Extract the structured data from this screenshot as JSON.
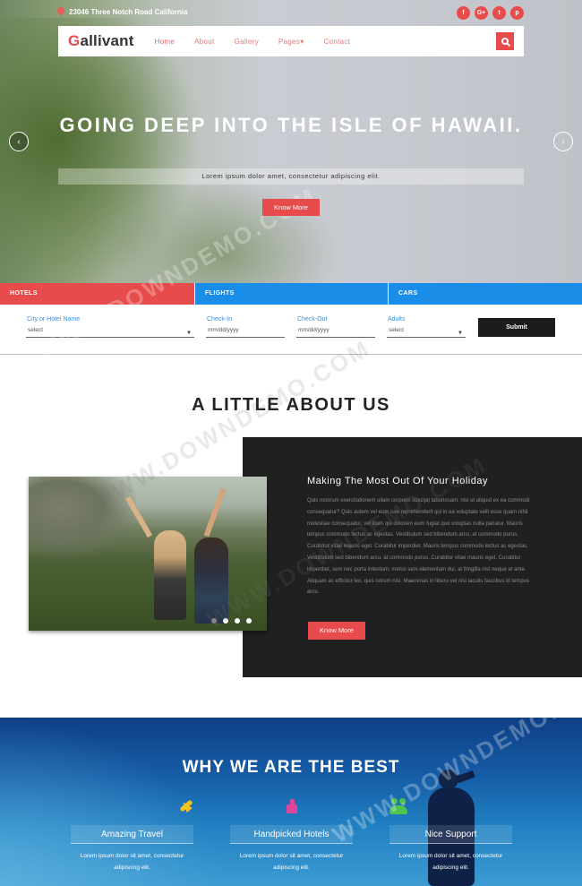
{
  "topbar": {
    "address": "23046 Three Notch Road California",
    "social": [
      "f",
      "G+",
      "t",
      "p"
    ]
  },
  "navbar": {
    "logo_first": "G",
    "logo_rest": "allivant",
    "menu": [
      "Home",
      "About",
      "Gallery",
      "Pages▾",
      "Contact"
    ],
    "search_icon": "search-icon"
  },
  "hero": {
    "title": "GOING DEEP INTO THE ISLE OF HAWAII.",
    "subtitle": "Lorem ipsum dolor amet, consectetur adipiscing elit.",
    "button": "Know More",
    "prev": "‹",
    "next": "›"
  },
  "booking": {
    "tabs": [
      "HOTELS",
      "FLIGHTS",
      "CARS"
    ],
    "fields": {
      "city": {
        "label": "City or Hotel Name",
        "value": "select"
      },
      "checkin": {
        "label": "Check-In",
        "value": "mm/dd/yyyy"
      },
      "checkout": {
        "label": "Check-Out",
        "value": "mm/dd/yyyy"
      },
      "adults": {
        "label": "Adults",
        "value": "select"
      }
    },
    "submit": "Submit"
  },
  "about": {
    "title": "A LITTLE ABOUT US",
    "heading": "Making The Most Out Of Your Holiday",
    "text": "Quis nostrum exercitationem ullam corporis suscipit laboriosam, nisi ut aliquid ex ea commodi consequatur? Quis autem vel eum iure reprehenderit qui in ea voluptate velit esse quam nihil molestiae consequatur, vel illum qui dolorem eum fugiat quo voluptas nulla pariatur. Mauris tempus commodo lectus ac egestas. Vestibulum sed bibendum arcu, at commodo purus. Curabitur vitae mauris eget. Curabitur imperdiet. Mauris tempus commodo lectus ac egestas. Vestibulum sed bibendum arcu, at commodo purus. Curabitur vitae mauris eget. Curabitur imperdiet, sem nec porta interdum, metus sem elementum dui, at fringilla nisl neque et ante. Aliquam ac efficitur leo, quis rutrum nisi. Maecenas in libero vel nisi iaculis faucibus id tempus arcu.",
    "button": "Know More"
  },
  "why": {
    "title": "WHY WE ARE THE BEST",
    "features": [
      {
        "title": "Amazing Travel",
        "text": "Lorem ipsum dolor sit amet, consectetur adipiscing elit.",
        "icon": "plane-icon"
      },
      {
        "title": "Handpicked Hotels",
        "text": "Lorem ipsum dolor sit amet, consectetur adipiscing elit.",
        "icon": "thumbs-up-icon"
      },
      {
        "title": "Nice Support",
        "text": "Lorem ipsum dolor sit amet, consectetur adipiscing elit.",
        "icon": "users-icon"
      }
    ]
  },
  "watermark": "WWW.DOWNDEMO.COM",
  "colors": {
    "accent": "#e84b4b",
    "blue": "#1a8de8",
    "dark": "#202020"
  }
}
